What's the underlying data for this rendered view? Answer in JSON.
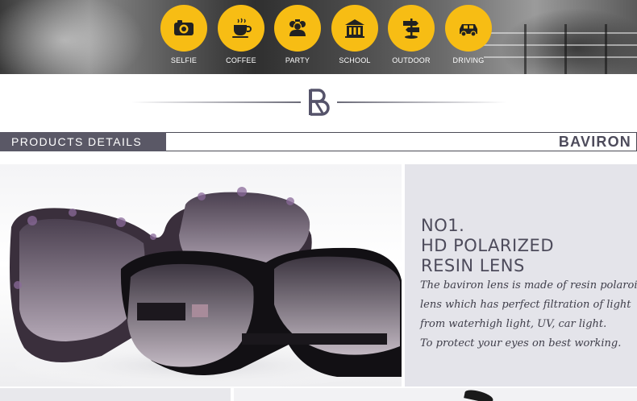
{
  "features": [
    {
      "label": "SELFIE",
      "icon": "camera-icon"
    },
    {
      "label": "COFFEE",
      "icon": "coffee-cup-icon"
    },
    {
      "label": "PARTY",
      "icon": "party-people-icon"
    },
    {
      "label": "SCHOOL",
      "icon": "school-building-icon"
    },
    {
      "label": "OUTDOOR",
      "icon": "signpost-icon"
    },
    {
      "label": "DRIVING",
      "icon": "car-icon"
    }
  ],
  "section": {
    "tag": "PRODUCTS DETAILS",
    "brand": "BAVIRON"
  },
  "product": {
    "title_lines": [
      "NO1.",
      "HD POLARIZED",
      "RESIN LENS"
    ],
    "description_lines": [
      "The baviron lens is made of resin polaroid",
      "lens which has perfect filtration of light",
      "from waterhigh light, UV, car light.",
      "To protect your eyes on best working."
    ]
  },
  "colors": {
    "icon_yellow": "#f7bd14",
    "brand_purple_gray": "#4d4b5b",
    "tag_background": "#5a5866",
    "info_background": "#e4e4ea"
  }
}
